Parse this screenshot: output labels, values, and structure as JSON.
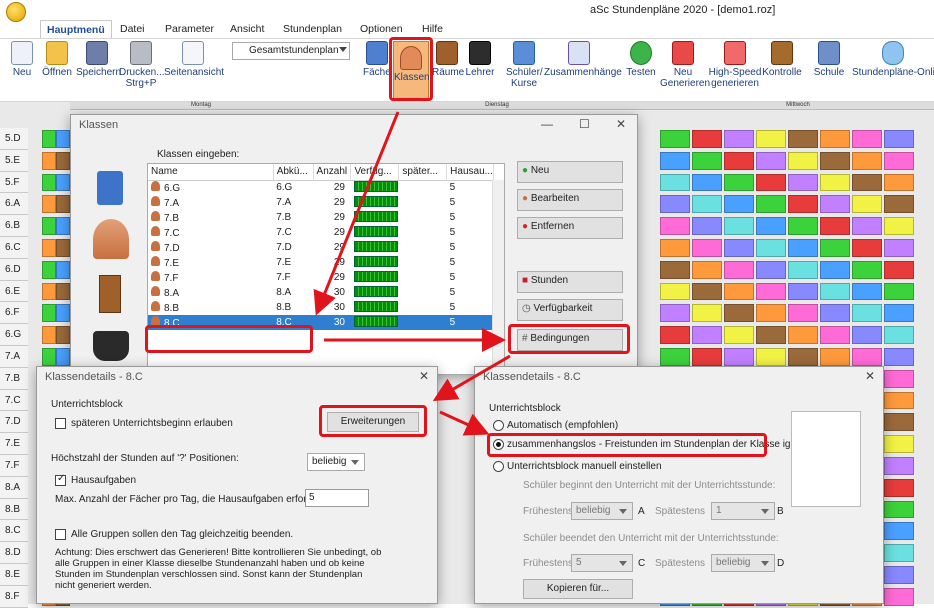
{
  "app_title": "aSc Stundenpläne 2020  -  [demo1.roz]",
  "tabs": [
    "Hauptmenü",
    "Datei",
    "Parameter",
    "Ansicht",
    "Stundenplan",
    "Optionen",
    "Hilfe"
  ],
  "ribbon": {
    "buttons": [
      {
        "label": "Neu",
        "icon": "new-file-icon"
      },
      {
        "label": "Öffnen",
        "icon": "folder-open-icon"
      },
      {
        "label": "Speichern",
        "icon": "save-icon"
      },
      {
        "label": "Drucken...\nStrg+P",
        "icon": "printer-icon"
      },
      {
        "label": "Seitenansicht",
        "icon": "page-preview-icon"
      },
      {
        "label": "Fächer",
        "icon": "book-icon"
      },
      {
        "label": "Klassen",
        "icon": "classes-icon"
      },
      {
        "label": "Räume",
        "icon": "door-icon"
      },
      {
        "label": "Lehrer",
        "icon": "graduation-cap-icon"
      },
      {
        "label": "Schüler/\nKurse",
        "icon": "students-icon"
      },
      {
        "label": "Zusammenhänge",
        "icon": "network-icon"
      },
      {
        "label": "Testen",
        "icon": "check-icon"
      },
      {
        "label": "Neu\nGenerieren",
        "icon": "generate-icon"
      },
      {
        "label": "High-Speed\ngenerieren",
        "icon": "high-speed-icon"
      },
      {
        "label": "Kontrolle",
        "icon": "gavel-icon"
      },
      {
        "label": "Schule",
        "icon": "school-icon"
      },
      {
        "label": "Stundenpläne-Online",
        "icon": "cloud-icon"
      }
    ],
    "view_select": "Gesamtstundenplan"
  },
  "grid": {
    "days": [
      "Montag",
      "Dienstag",
      "Mittwoch"
    ],
    "rows": [
      "5.D",
      "5.E",
      "5.F",
      "6.A",
      "6.B",
      "6.C",
      "6.D",
      "6.E",
      "6.F",
      "6.G",
      "7.A",
      "7.B",
      "7.C",
      "7.D",
      "7.E",
      "7.F",
      "8.A",
      "8.B",
      "8.C",
      "8.D",
      "8.E",
      "8.F"
    ]
  },
  "klassen_dialog": {
    "title": "Klassen",
    "prompt": "Klassen eingeben:",
    "columns": [
      "Name",
      "Abkü...",
      "Anzahl",
      "Verfüg...",
      "später...",
      "Hausau..."
    ],
    "rows": [
      {
        "name": "6.G",
        "abbr": "6.G",
        "count": "29",
        "hw": "5"
      },
      {
        "name": "7.A",
        "abbr": "7.A",
        "count": "29",
        "hw": "5"
      },
      {
        "name": "7.B",
        "abbr": "7.B",
        "count": "29",
        "hw": "5"
      },
      {
        "name": "7.C",
        "abbr": "7.C",
        "count": "29",
        "hw": "5"
      },
      {
        "name": "7.D",
        "abbr": "7.D",
        "count": "29",
        "hw": "5"
      },
      {
        "name": "7.E",
        "abbr": "7.E",
        "count": "29",
        "hw": "5"
      },
      {
        "name": "7.F",
        "abbr": "7.F",
        "count": "29",
        "hw": "5"
      },
      {
        "name": "8.A",
        "abbr": "8.A",
        "count": "30",
        "hw": "5"
      },
      {
        "name": "8.B",
        "abbr": "8.B",
        "count": "30",
        "hw": "5"
      },
      {
        "name": "8.C",
        "abbr": "8.C",
        "count": "30",
        "hw": "5"
      }
    ],
    "buttons": {
      "neu": "Neu",
      "bearbeiten": "Bearbeiten",
      "entfernen": "Entfernen",
      "stunden": "Stunden",
      "verfuegbarkeit": "Verfügbarkeit",
      "bedingungen": "Bedingungen"
    }
  },
  "details_left": {
    "title": "Klassendetails - 8.C",
    "group": "Unterrichtsblock",
    "spaeter": "späteren Unterrichtsbeginn erlauben",
    "erweiterungen": "Erweiterungen",
    "max_label": "Höchstzahl der Stunden auf '?' Positionen:",
    "max_value": "beliebig",
    "hausaufgaben": "Hausaufgaben",
    "hausaufgaben_label": "Max. Anzahl der Fächer pro Tag, die  Hausaufgaben erfordern",
    "hausaufgaben_value": "5",
    "gruppen": "Alle Gruppen sollen den Tag gleichzeitig beenden.",
    "warnung": "Achtung: Dies erschwert das Generieren! Bitte kontrollieren Sie unbedingt, ob alle Gruppen in einer Klasse dieselbe Stundenanzahl haben und ob keine Stunden im Stundenplan verschlossen sind. Sonst kann der Stundenplan nicht generiert werden."
  },
  "details_right": {
    "title": "Klassendetails - 8.C",
    "group": "Unterrichtsblock",
    "opt_auto": "Automatisch (empfohlen)",
    "opt_zus": "zusammenhangslos - Freistunden im Stundenplan der Klasse ignor",
    "opt_manual": "Unterrichtsblock manuell einstellen",
    "beginnt": "Schüler beginnt den Unterricht mit der Unterrichtsstunde:",
    "beendet": "Schüler beendet den Unterricht mit der Unterrichtsstunde:",
    "fruehestens": "Frühestens",
    "spaetestens": "Spätestens",
    "beliebig": "beliebig",
    "one": "1",
    "five": "5",
    "A": "A",
    "B": "B",
    "C": "C",
    "D": "D",
    "kopieren": "Kopieren für..."
  }
}
